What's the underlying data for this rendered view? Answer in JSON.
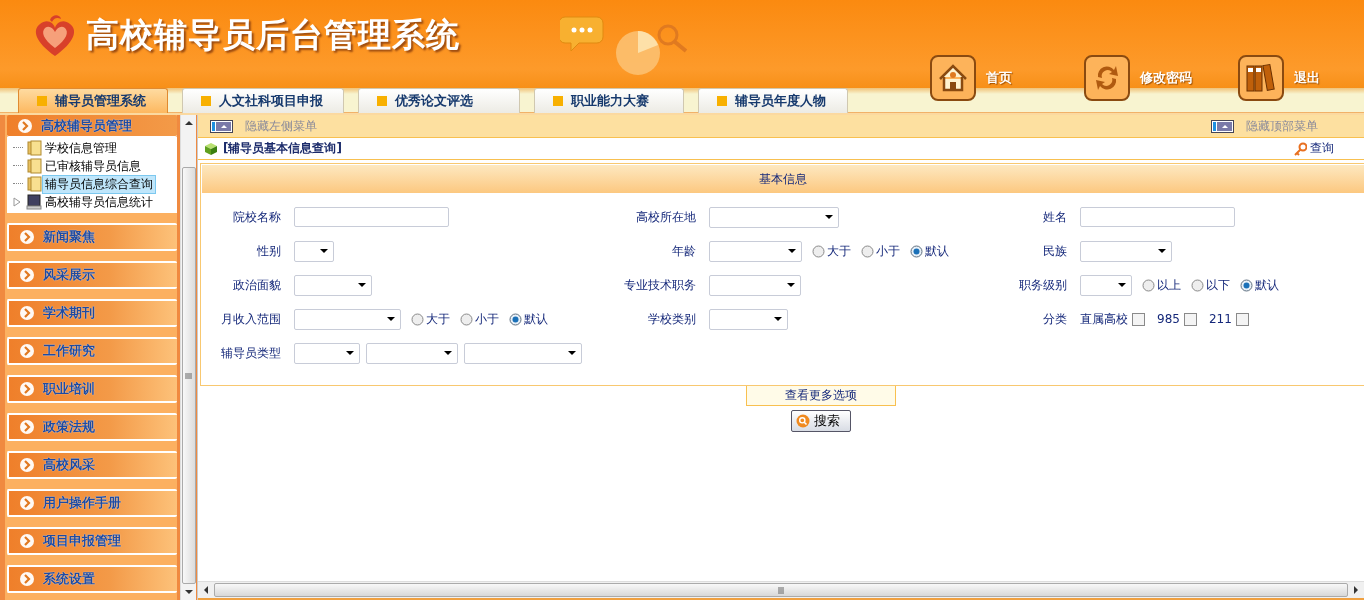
{
  "header": {
    "title": "高校辅导员后台管理系统",
    "nav_links": [
      {
        "label": "首页"
      },
      {
        "label": "修改密码"
      },
      {
        "label": "退出"
      }
    ],
    "tabs": [
      {
        "label": "辅导员管理系统",
        "selected": true
      },
      {
        "label": "人文社科项目申报",
        "selected": false
      },
      {
        "label": "优秀论文评选",
        "selected": false
      },
      {
        "label": "职业能力大赛",
        "selected": false
      },
      {
        "label": "辅导员年度人物",
        "selected": false
      }
    ]
  },
  "sidebar": {
    "sections": [
      {
        "label": "高校辅导员管理",
        "expanded": true,
        "children": [
          {
            "label": "学校信息管理",
            "kind": "folder",
            "selected": false,
            "expandable": false
          },
          {
            "label": "已审核辅导员信息",
            "kind": "folder",
            "selected": false,
            "expandable": false
          },
          {
            "label": "辅导员信息综合查询",
            "kind": "folder",
            "selected": true,
            "expandable": false
          },
          {
            "label": "高校辅导员信息统计",
            "kind": "drive",
            "selected": false,
            "expandable": true
          }
        ]
      },
      {
        "label": "新闻聚焦",
        "expanded": false
      },
      {
        "label": "风采展示",
        "expanded": false
      },
      {
        "label": "学术期刊",
        "expanded": false
      },
      {
        "label": "工作研究",
        "expanded": false
      },
      {
        "label": "职业培训",
        "expanded": false
      },
      {
        "label": "政策法规",
        "expanded": false
      },
      {
        "label": "高校风采",
        "expanded": false
      },
      {
        "label": "用户操作手册",
        "expanded": false
      },
      {
        "label": "项目申报管理",
        "expanded": false
      },
      {
        "label": "系统设置",
        "expanded": false
      }
    ]
  },
  "toolbar": {
    "hide_left": "隐藏左侧菜单",
    "hide_top": "隐藏顶部菜单"
  },
  "page_title": "[辅导员基本信息查询]",
  "query_link": "查询",
  "form": {
    "heading": "基本信息",
    "rows": [
      {
        "left": {
          "label": "院校名称",
          "controls": [
            {
              "kind": "text"
            }
          ]
        },
        "middle": {
          "label": "高校所在地",
          "controls": [
            {
              "kind": "select"
            }
          ]
        },
        "right": {
          "label": "姓名",
          "controls": [
            {
              "kind": "text"
            }
          ]
        }
      },
      {
        "left": {
          "label": "性别",
          "controls": [
            {
              "kind": "select"
            }
          ]
        },
        "middle": {
          "label": "年龄",
          "controls": [
            {
              "kind": "select"
            },
            {
              "kind": "radio",
              "label": "大于",
              "selected": false
            },
            {
              "kind": "radio",
              "label": "小于",
              "selected": false
            },
            {
              "kind": "radio",
              "label": "默认",
              "selected": true
            }
          ]
        },
        "right": {
          "label": "民族",
          "controls": [
            {
              "kind": "select"
            }
          ]
        }
      },
      {
        "left": {
          "label": "政治面貌",
          "controls": [
            {
              "kind": "select"
            }
          ]
        },
        "middle": {
          "label": "专业技术职务",
          "controls": [
            {
              "kind": "select"
            }
          ]
        },
        "right": {
          "label": "职务级别",
          "controls": [
            {
              "kind": "select"
            },
            {
              "kind": "radio",
              "label": "以上",
              "selected": false
            },
            {
              "kind": "radio",
              "label": "以下",
              "selected": false
            },
            {
              "kind": "radio",
              "label": "默认",
              "selected": true
            }
          ]
        }
      },
      {
        "left": {
          "label": "月收入范围",
          "controls": [
            {
              "kind": "select"
            },
            {
              "kind": "radio",
              "label": "大于",
              "selected": false
            },
            {
              "kind": "radio",
              "label": "小于",
              "selected": false
            },
            {
              "kind": "radio",
              "label": "默认",
              "selected": true
            }
          ]
        },
        "middle": {
          "label": "学校类别",
          "controls": [
            {
              "kind": "select"
            }
          ]
        },
        "right": {
          "label": "分类",
          "controls": [
            {
              "kind": "checkbox",
              "label": "直属高校",
              "checked": false
            },
            {
              "kind": "checkbox",
              "label": "985",
              "checked": false
            },
            {
              "kind": "checkbox",
              "label": "211",
              "checked": false
            }
          ]
        }
      },
      {
        "left": {
          "label": "辅导员类型",
          "controls": [
            {
              "kind": "select"
            },
            {
              "kind": "select"
            },
            {
              "kind": "select"
            }
          ]
        }
      }
    ],
    "more_options": "查看更多选项",
    "search_button": "搜索"
  }
}
